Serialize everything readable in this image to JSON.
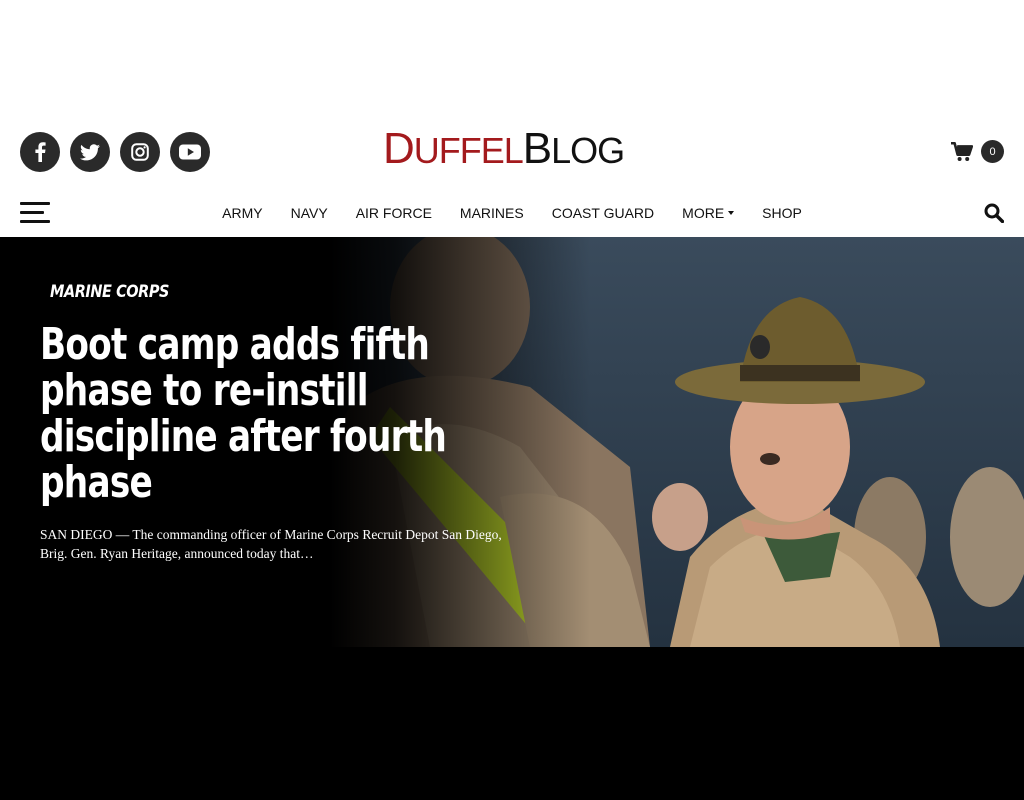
{
  "logo": {
    "part1_initial": "D",
    "part1_rest": "UFFEL",
    "part2_initial": "B",
    "part2_rest": "LOG",
    "color_primary": "#a31a1d",
    "color_secondary": "#111111"
  },
  "social": [
    {
      "name": "facebook-icon"
    },
    {
      "name": "twitter-icon"
    },
    {
      "name": "instagram-icon"
    },
    {
      "name": "youtube-icon"
    }
  ],
  "cart": {
    "count": "0"
  },
  "nav": {
    "items": [
      "ARMY",
      "NAVY",
      "AIR FORCE",
      "MARINES",
      "COAST GUARD",
      "MORE",
      "SHOP"
    ]
  },
  "hero": {
    "category": "MARINE CORPS",
    "headline": "Boot camp adds fifth phase to re-instill discipline after fourth phase",
    "excerpt": "SAN DIEGO — The commanding officer of Marine Corps Recruit Depot San Diego, Brig. Gen. Ryan Heritage, announced today that…"
  }
}
